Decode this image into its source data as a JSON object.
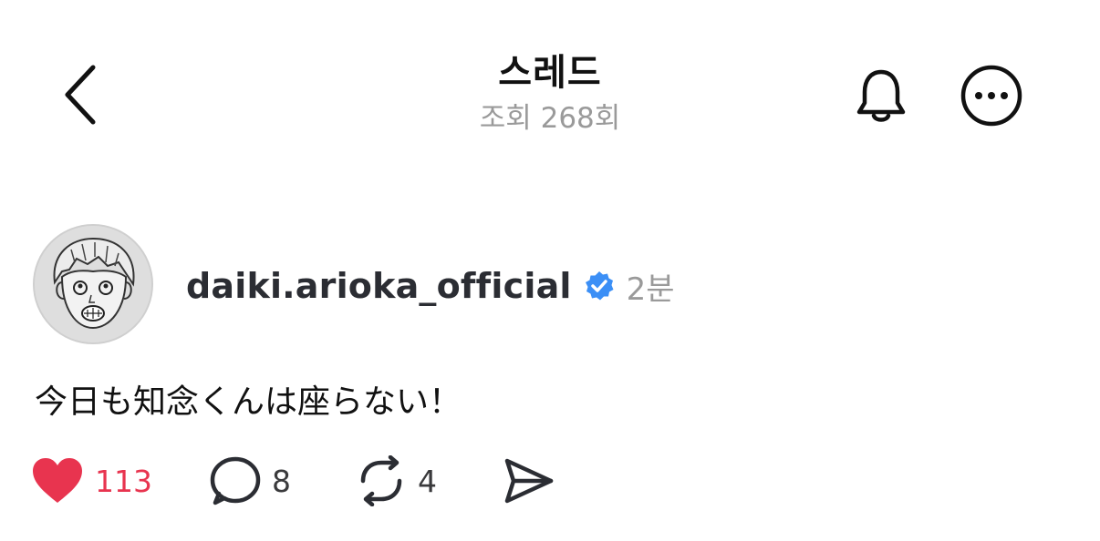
{
  "header": {
    "title": "스레드",
    "views": "조회 268회"
  },
  "post": {
    "author": "daiki.arioka_official",
    "verified": true,
    "time": "2분",
    "text": "今日も知念くんは座らない！"
  },
  "actions": {
    "likes": "113",
    "replies": "8",
    "reposts": "4"
  },
  "colors": {
    "like_red": "#e8344f",
    "verified_blue": "#3b8ff6",
    "muted_gray": "#9a9a9a"
  },
  "icons": {
    "back": "chevron-left-icon",
    "bell": "bell-icon",
    "more": "more-horizontal-icon",
    "heart": "heart-filled-icon",
    "comment": "comment-bubble-icon",
    "repost": "repost-icon",
    "share": "send-icon"
  }
}
